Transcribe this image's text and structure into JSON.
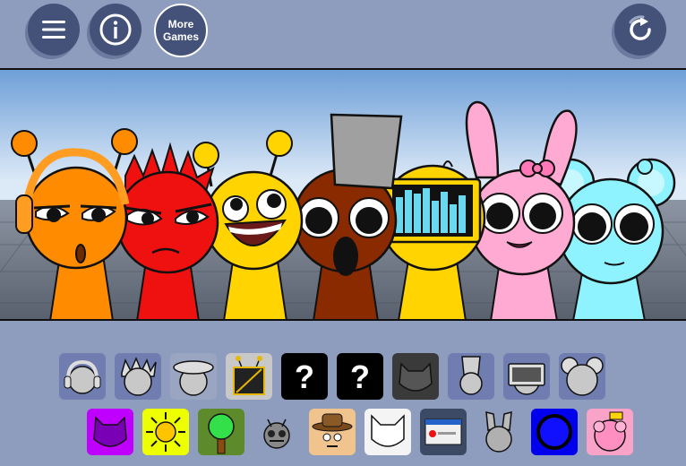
{
  "header": {
    "menu_icon": "hamburger-icon",
    "info_icon": "info-icon",
    "more_games_line1": "More",
    "more_games_line2": "Games",
    "reset_icon": "reset-icon"
  },
  "stage": {
    "characters": [
      "orange-headphones",
      "red-spiky",
      "yellow-antenna-smile",
      "brown-top-hat",
      "yellow-monitor",
      "pink-bunny",
      "cyan-mouse"
    ]
  },
  "tray": {
    "row1": [
      "headphones-icon",
      "spikes-icon",
      "cap-icon",
      "antenna-tv-icon",
      "question-mark-icon",
      "question-mark-icon",
      "cat-silhouette-icon",
      "top-hat-icon",
      "monitor-icon",
      "mouse-ears-icon"
    ],
    "row2": [
      "purple-cat-icon",
      "sun-icon",
      "tree-icon",
      "robot-bug-icon",
      "cowboy-hat-icon",
      "white-cat-icon",
      "error-window-icon",
      "bunny-icon",
      "blue-ring-icon",
      "pink-pig-icon"
    ],
    "question_label": "?"
  },
  "colors": {
    "background": "#8e9cbe",
    "button": "#44527a",
    "orange": "#ff8c00",
    "red": "#ef1010",
    "yellow": "#ffd400",
    "brown": "#8a2a00",
    "pink": "#ffaad2",
    "cyan": "#8ef2ff"
  }
}
